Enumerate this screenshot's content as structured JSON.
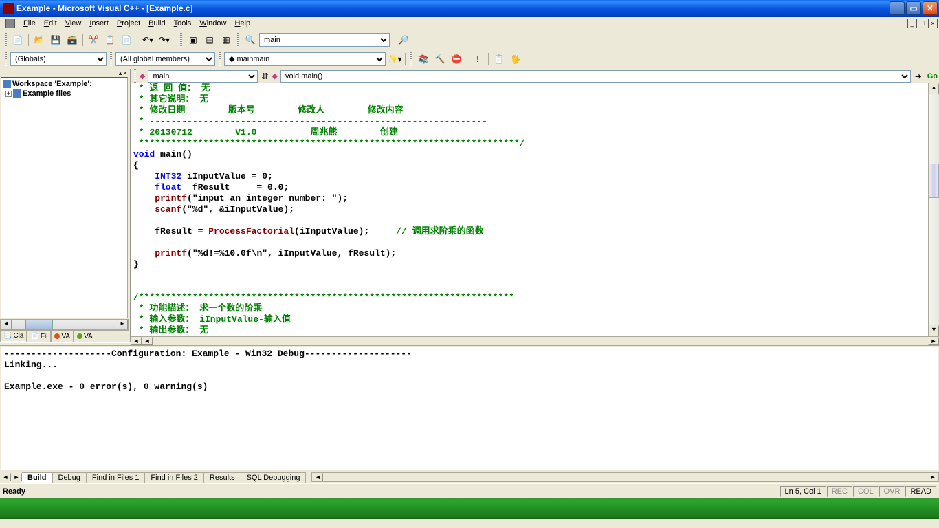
{
  "title": "Example - Microsoft Visual C++ - [Example.c]",
  "menu": {
    "file": "File",
    "edit": "Edit",
    "view": "View",
    "insert": "Insert",
    "project": "Project",
    "build": "Build",
    "tools": "Tools",
    "window": "Window",
    "help": "Help"
  },
  "toolbar": {
    "find_combo": "main",
    "scope1": "(Globals)",
    "scope2": "(All global members)",
    "scope3": "main"
  },
  "nav": {
    "left_combo": "main",
    "right_combo": "void main()",
    "go": "Go"
  },
  "workspace": {
    "root": "Workspace 'Example':",
    "item1": "Example files",
    "tabs": {
      "cla": "Cla",
      "fil": "Fil",
      "va": "VA",
      "va2": "VA"
    }
  },
  "code": {
    "l1": " * 返 回 值： 无",
    "l2": " * 其它说明： 无",
    "l3": " * 修改日期        版本号        修改人        修改内容",
    "l4": " * ---------------------------------------------------------------",
    "l5": " * 20130712        V1.0          周兆熊        创建",
    "l6": " ***********************************************************************/",
    "l7a": "void",
    "l7b": " main()",
    "l8": "{",
    "l9a": "    INT32",
    "l9b": " iInputValue = ",
    "l9c": "0",
    "l9d": ";",
    "l10a": "    float",
    "l10b": "  fResult     = ",
    "l10c": "0.0",
    "l10d": ";",
    "l11a": "    printf",
    "l11b": "(",
    "l11c": "\"input an integer number: \"",
    "l11d": ");",
    "l12a": "    scanf",
    "l12b": "(",
    "l12c": "\"%d\"",
    "l12d": ", &iInputValue);",
    "l13": "",
    "l14a": "    fResult = ",
    "l14b": "ProcessFactorial",
    "l14c": "(iInputValue);     ",
    "l14d": "// 调用求阶乘的函数",
    "l15": "",
    "l16a": "    printf",
    "l16b": "(",
    "l16c": "\"%d!=%10.0f\\n\"",
    "l16d": ", iInputValue, fResult);",
    "l17": "}",
    "l18": "",
    "l19": "",
    "l20": "/**********************************************************************",
    "l21": " * 功能描述： 求一个数的阶乘",
    "l22": " * 输入参数： iInputValue-输入值",
    "l23": " * 输出参数： 无"
  },
  "output": {
    "l1": "--------------------Configuration: Example - Win32 Debug--------------------",
    "l2": "Linking...",
    "l3": "",
    "l4": "Example.exe - 0 error(s), 0 warning(s)",
    "tabs": {
      "build": "Build",
      "debug": "Debug",
      "fif1": "Find in Files 1",
      "fif2": "Find in Files 2",
      "results": "Results",
      "sql": "SQL Debugging"
    }
  },
  "status": {
    "ready": "Ready",
    "pos": "Ln 5, Col 1",
    "rec": "REC",
    "col": "COL",
    "ovr": "OVR",
    "read": "READ"
  }
}
